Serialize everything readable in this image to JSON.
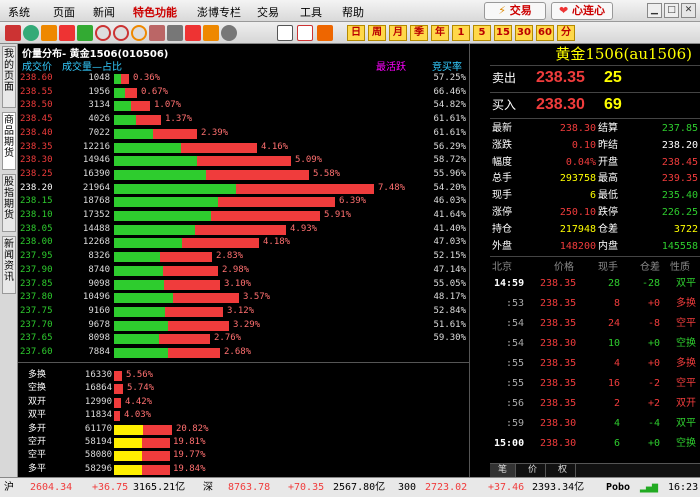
{
  "menu": {
    "items": [
      "系统",
      "页面",
      "新闻",
      "特色功能",
      "澎博专栏",
      "交易",
      "工具",
      "帮助"
    ],
    "trade_button": "交易",
    "heart_button": "心连心"
  },
  "toolbar": {
    "text_buttons": [
      "日",
      "周",
      "月",
      "季",
      "年",
      "1",
      "5",
      "15",
      "30",
      "60",
      "分"
    ]
  },
  "left_tabs": [
    "我的页面",
    "商品期货",
    "股指期货",
    "新闻资讯"
  ],
  "distribution": {
    "title": "价量分布- 黄金1506(010506)",
    "col_price": "成交价",
    "col_volume": "成交量—占比",
    "col_active": "最活跃",
    "col_ratio": "竞买率",
    "rows": [
      {
        "price": "238.60",
        "volume": "1048",
        "pct": "0.36%",
        "ratio": "57.25%",
        "pcolor": "red",
        "active": 0.06
      },
      {
        "price": "238.55",
        "volume": "1956",
        "pct": "0.67%",
        "ratio": "66.46%",
        "pcolor": "red",
        "active": 0.09
      },
      {
        "price": "238.50",
        "volume": "3134",
        "pct": "1.07%",
        "ratio": "54.82%",
        "pcolor": "red",
        "active": 0.14
      },
      {
        "price": "238.45",
        "volume": "4026",
        "pct": "1.37%",
        "ratio": "61.61%",
        "pcolor": "red",
        "active": 0.18
      },
      {
        "price": "238.40",
        "volume": "7022",
        "pct": "2.39%",
        "ratio": "61.61%",
        "pcolor": "red",
        "active": 0.32
      },
      {
        "price": "238.35",
        "volume": "12216",
        "pct": "4.16%",
        "ratio": "56.29%",
        "pcolor": "red",
        "active": 0.55
      },
      {
        "price": "238.30",
        "volume": "14946",
        "pct": "5.09%",
        "ratio": "58.72%",
        "pcolor": "red",
        "active": 0.68
      },
      {
        "price": "238.25",
        "volume": "16390",
        "pct": "5.58%",
        "ratio": "55.96%",
        "pcolor": "red",
        "active": 0.75
      },
      {
        "price": "238.20",
        "volume": "21964",
        "pct": "7.48%",
        "ratio": "54.20%",
        "pcolor": "white",
        "active": 1.0
      },
      {
        "price": "238.15",
        "volume": "18768",
        "pct": "6.39%",
        "ratio": "46.03%",
        "pcolor": "green",
        "active": 0.85
      },
      {
        "price": "238.10",
        "volume": "17352",
        "pct": "5.91%",
        "ratio": "41.64%",
        "pcolor": "green",
        "active": 0.79
      },
      {
        "price": "238.05",
        "volume": "14488",
        "pct": "4.93%",
        "ratio": "41.40%",
        "pcolor": "green",
        "active": 0.66
      },
      {
        "price": "238.00",
        "volume": "12268",
        "pct": "4.18%",
        "ratio": "47.03%",
        "pcolor": "green",
        "active": 0.56
      },
      {
        "price": "237.95",
        "volume": "8326",
        "pct": "2.83%",
        "ratio": "52.15%",
        "pcolor": "green",
        "active": 0.38
      },
      {
        "price": "237.90",
        "volume": "8740",
        "pct": "2.98%",
        "ratio": "47.14%",
        "pcolor": "green",
        "active": 0.4
      },
      {
        "price": "237.85",
        "volume": "9098",
        "pct": "3.10%",
        "ratio": "55.05%",
        "pcolor": "green",
        "active": 0.41
      },
      {
        "price": "237.80",
        "volume": "10496",
        "pct": "3.57%",
        "ratio": "48.17%",
        "pcolor": "green",
        "active": 0.48
      },
      {
        "price": "237.75",
        "volume": "9160",
        "pct": "3.12%",
        "ratio": "52.84%",
        "pcolor": "green",
        "active": 0.42
      },
      {
        "price": "237.70",
        "volume": "9678",
        "pct": "3.29%",
        "ratio": "51.61%",
        "pcolor": "green",
        "active": 0.44
      },
      {
        "price": "237.65",
        "volume": "8098",
        "pct": "2.76%",
        "ratio": "59.30%",
        "pcolor": "green",
        "active": 0.37
      }
    ],
    "partial_row": {
      "price": "237.60",
      "volume": "7884",
      "pct": "2.68%"
    }
  },
  "categories": {
    "rows": [
      {
        "label": "多换",
        "volume": "16330",
        "pct": "5.56%",
        "color": "red",
        "fill": 0.28
      },
      {
        "label": "空换",
        "volume": "16864",
        "pct": "5.74%",
        "color": "red",
        "fill": 0.29
      },
      {
        "label": "双开",
        "volume": "12990",
        "pct": "4.42%",
        "color": "red",
        "fill": 0.22
      },
      {
        "label": "双平",
        "volume": "11834",
        "pct": "4.03%",
        "color": "red",
        "fill": 0.2
      },
      {
        "label": "多开",
        "volume": "61170",
        "pct": "20.82%",
        "color": "yellow",
        "fill": 1.0
      },
      {
        "label": "空开",
        "volume": "58194",
        "pct": "19.81%",
        "color": "yellow",
        "fill": 0.95
      },
      {
        "label": "空平",
        "volume": "58080",
        "pct": "19.77%",
        "color": "yellow",
        "fill": 0.95
      },
      {
        "label": "多平",
        "volume": "58296",
        "pct": "19.84%",
        "color": "yellow",
        "fill": 0.95
      }
    ]
  },
  "quote": {
    "title": "黄金1506(au1506)",
    "ask_label": "卖出",
    "ask_price": "238.35",
    "ask_vol": "25",
    "bid_label": "买入",
    "bid_price": "238.30",
    "bid_vol": "69",
    "stats": [
      [
        {
          "l": "最新",
          "v": "238.30",
          "c": "red"
        },
        {
          "l": "结算",
          "v": "237.85",
          "c": "green"
        }
      ],
      [
        {
          "l": "涨跌",
          "v": "0.10",
          "c": "red"
        },
        {
          "l": "昨结",
          "v": "238.20",
          "c": "white"
        }
      ],
      [
        {
          "l": "幅度",
          "v": "0.04%",
          "c": "red"
        },
        {
          "l": "开盘",
          "v": "238.45",
          "c": "red"
        }
      ],
      [
        {
          "l": "总手",
          "v": "293758",
          "c": "yellow"
        },
        {
          "l": "最高",
          "v": "239.35",
          "c": "red"
        }
      ],
      [
        {
          "l": "现手",
          "v": "6",
          "c": "yellow"
        },
        {
          "l": "最低",
          "v": "235.40",
          "c": "green"
        }
      ],
      [
        {
          "l": "涨停",
          "v": "250.10",
          "c": "red"
        },
        {
          "l": "跌停",
          "v": "226.25",
          "c": "green"
        }
      ],
      [
        {
          "l": "持仓",
          "v": "217948",
          "c": "yellow"
        },
        {
          "l": "仓差",
          "v": "3722",
          "c": "yellow"
        }
      ],
      [
        {
          "l": "外盘",
          "v": "148200",
          "c": "red"
        },
        {
          "l": "内盘",
          "v": "145558",
          "c": "green"
        }
      ]
    ],
    "tick_headers": [
      "北京",
      "价格",
      "现手",
      "仓差",
      "性质"
    ],
    "ticks": [
      {
        "time": "14:59",
        "price": "238.35",
        "vol": "28",
        "diff": "-28",
        "type": "双平",
        "vc": "green",
        "dc": "green",
        "tc": "green",
        "big": true
      },
      {
        "time": ":53",
        "price": "238.35",
        "vol": "8",
        "diff": "+0",
        "type": "多换",
        "vc": "red",
        "dc": "red",
        "tc": "red",
        "big": false
      },
      {
        "time": ":54",
        "price": "238.35",
        "vol": "24",
        "diff": "-8",
        "type": "空平",
        "vc": "red",
        "dc": "red",
        "tc": "red",
        "big": false
      },
      {
        "time": ":54",
        "price": "238.30",
        "vol": "10",
        "diff": "+0",
        "type": "空换",
        "vc": "green",
        "dc": "green",
        "tc": "green",
        "big": false
      },
      {
        "time": ":55",
        "price": "238.35",
        "vol": "4",
        "diff": "+0",
        "type": "多换",
        "vc": "red",
        "dc": "red",
        "tc": "red",
        "big": false
      },
      {
        "time": ":55",
        "price": "238.35",
        "vol": "16",
        "diff": "-2",
        "type": "空平",
        "vc": "red",
        "dc": "red",
        "tc": "red",
        "big": false
      },
      {
        "time": ":56",
        "price": "238.35",
        "vol": "2",
        "diff": "+2",
        "type": "双开",
        "vc": "red",
        "dc": "red",
        "tc": "red",
        "big": false
      },
      {
        "time": ":59",
        "price": "238.30",
        "vol": "4",
        "diff": "-4",
        "type": "双平",
        "vc": "green",
        "dc": "green",
        "tc": "green",
        "big": false
      },
      {
        "time": "15:00",
        "price": "238.30",
        "vol": "6",
        "diff": "+0",
        "type": "空换",
        "vc": "green",
        "dc": "green",
        "tc": "green",
        "big": true
      }
    ],
    "bottom_tabs": [
      "笔",
      "价",
      "权"
    ]
  },
  "status": {
    "sh_label": "沪",
    "sh_index": "2604.34",
    "sh_change": "+36.75",
    "sh_amount": "3165.21亿",
    "sz_label": "深",
    "sz_index": "8763.78",
    "sz_change": "+70.35",
    "sz_amount": "2567.80亿",
    "cy_index": "300",
    "cy_value": "2723.02",
    "cy_change": "+37.46",
    "cy_amount": "2393.34亿",
    "brand": "Pobo",
    "time": "16:23"
  }
}
